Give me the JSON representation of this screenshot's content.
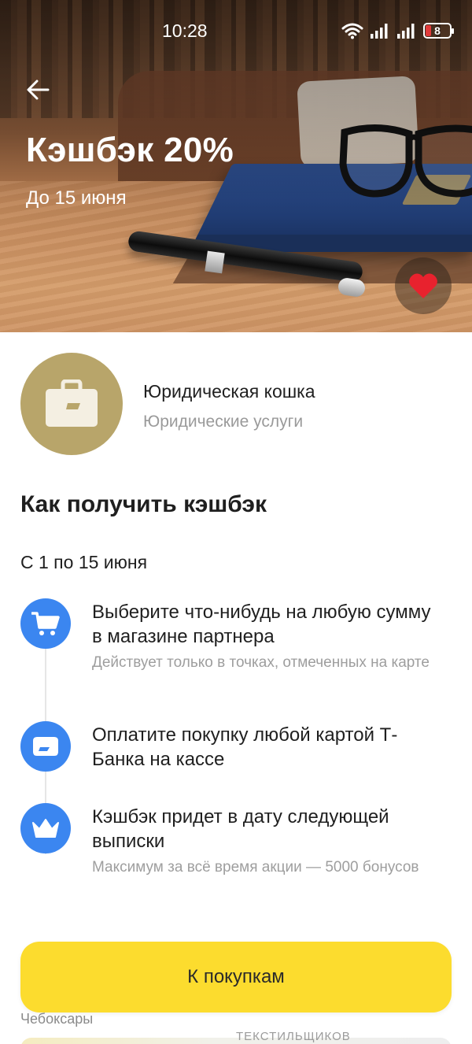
{
  "status_bar": {
    "time": "10:28",
    "battery": "8"
  },
  "header": {
    "title": "Кэшбэк 20%",
    "subtitle": "До 15 июня"
  },
  "merchant": {
    "name": "Юридическая кошка",
    "category": "Юридические услуги"
  },
  "how_to": {
    "title": "Как получить кэшбэк",
    "period": "С 1 по 15 июня",
    "steps": [
      {
        "icon": "cart-icon",
        "text": "Выберите что-нибудь на любую сумму в магазине партнера",
        "note": "Действует только в точках, отмеченных на карте"
      },
      {
        "icon": "card-icon",
        "text": "Оплатите покупку любой картой Т-Банка на кассе",
        "note": ""
      },
      {
        "icon": "crown-icon",
        "text": "Кэшбэк придет в дату следующей выписки",
        "note": "Максимум за всё время акции — 5000 бонусов"
      }
    ]
  },
  "map_preview": {
    "city": "Чебоксары",
    "street": "ТЕКСТИЛЬЩИКОВ"
  },
  "cta": {
    "label": "К покупкам"
  },
  "colors": {
    "accent_yellow": "#fcdc2e",
    "step_blue": "#3b86f0",
    "merchant_gold": "#b8a56a",
    "favorite_red": "#e8222e"
  }
}
